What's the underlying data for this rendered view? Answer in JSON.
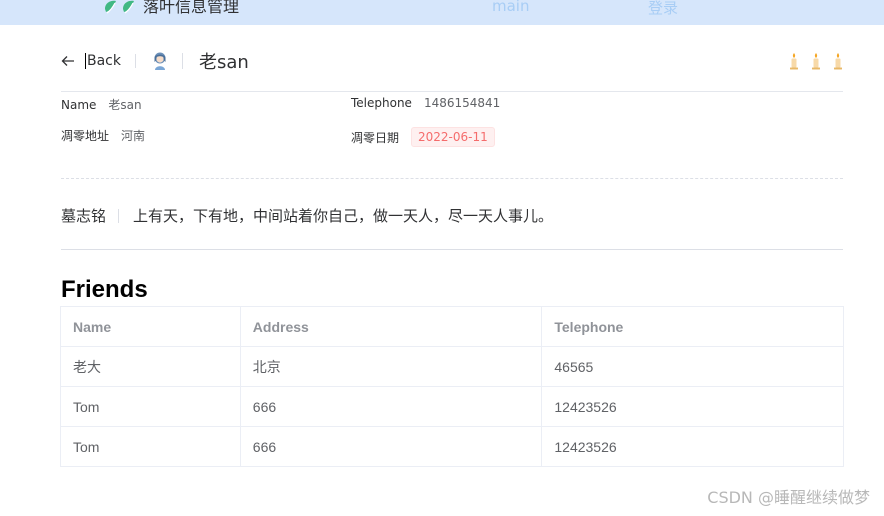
{
  "topnav": {
    "logo_text": "落叶信息管理",
    "links": [
      "main",
      "登录"
    ]
  },
  "header": {
    "back_label": "Back",
    "title": "老san"
  },
  "descriptions": {
    "name_label": "Name",
    "name_value": "老san",
    "telephone_label": "Telephone",
    "telephone_value": "1486154841",
    "address_label": "凋零地址",
    "address_value": "河南",
    "date_label": "凋零日期",
    "date_value": "2022-06-11"
  },
  "epitaph": {
    "label": "墓志铭",
    "text": "上有天，下有地，中间站着你自己，做一天人，尽一天人事儿。"
  },
  "friends": {
    "title": "Friends",
    "columns": [
      "Name",
      "Address",
      "Telephone"
    ],
    "rows": [
      [
        "老大",
        "北京",
        "46565"
      ],
      [
        "Tom",
        "666",
        "12423526"
      ],
      [
        "Tom",
        "666",
        "12423526"
      ]
    ]
  },
  "watermark": "CSDN @睡醒继续做梦",
  "colors": {
    "nav_bg": "#d6e6fb",
    "tag_danger": "#f56c6c",
    "logo_green": "#41b883"
  },
  "icons": [
    "leaf-logo-icon",
    "back-arrow-icon",
    "avatar-icon",
    "candle-icon"
  ]
}
